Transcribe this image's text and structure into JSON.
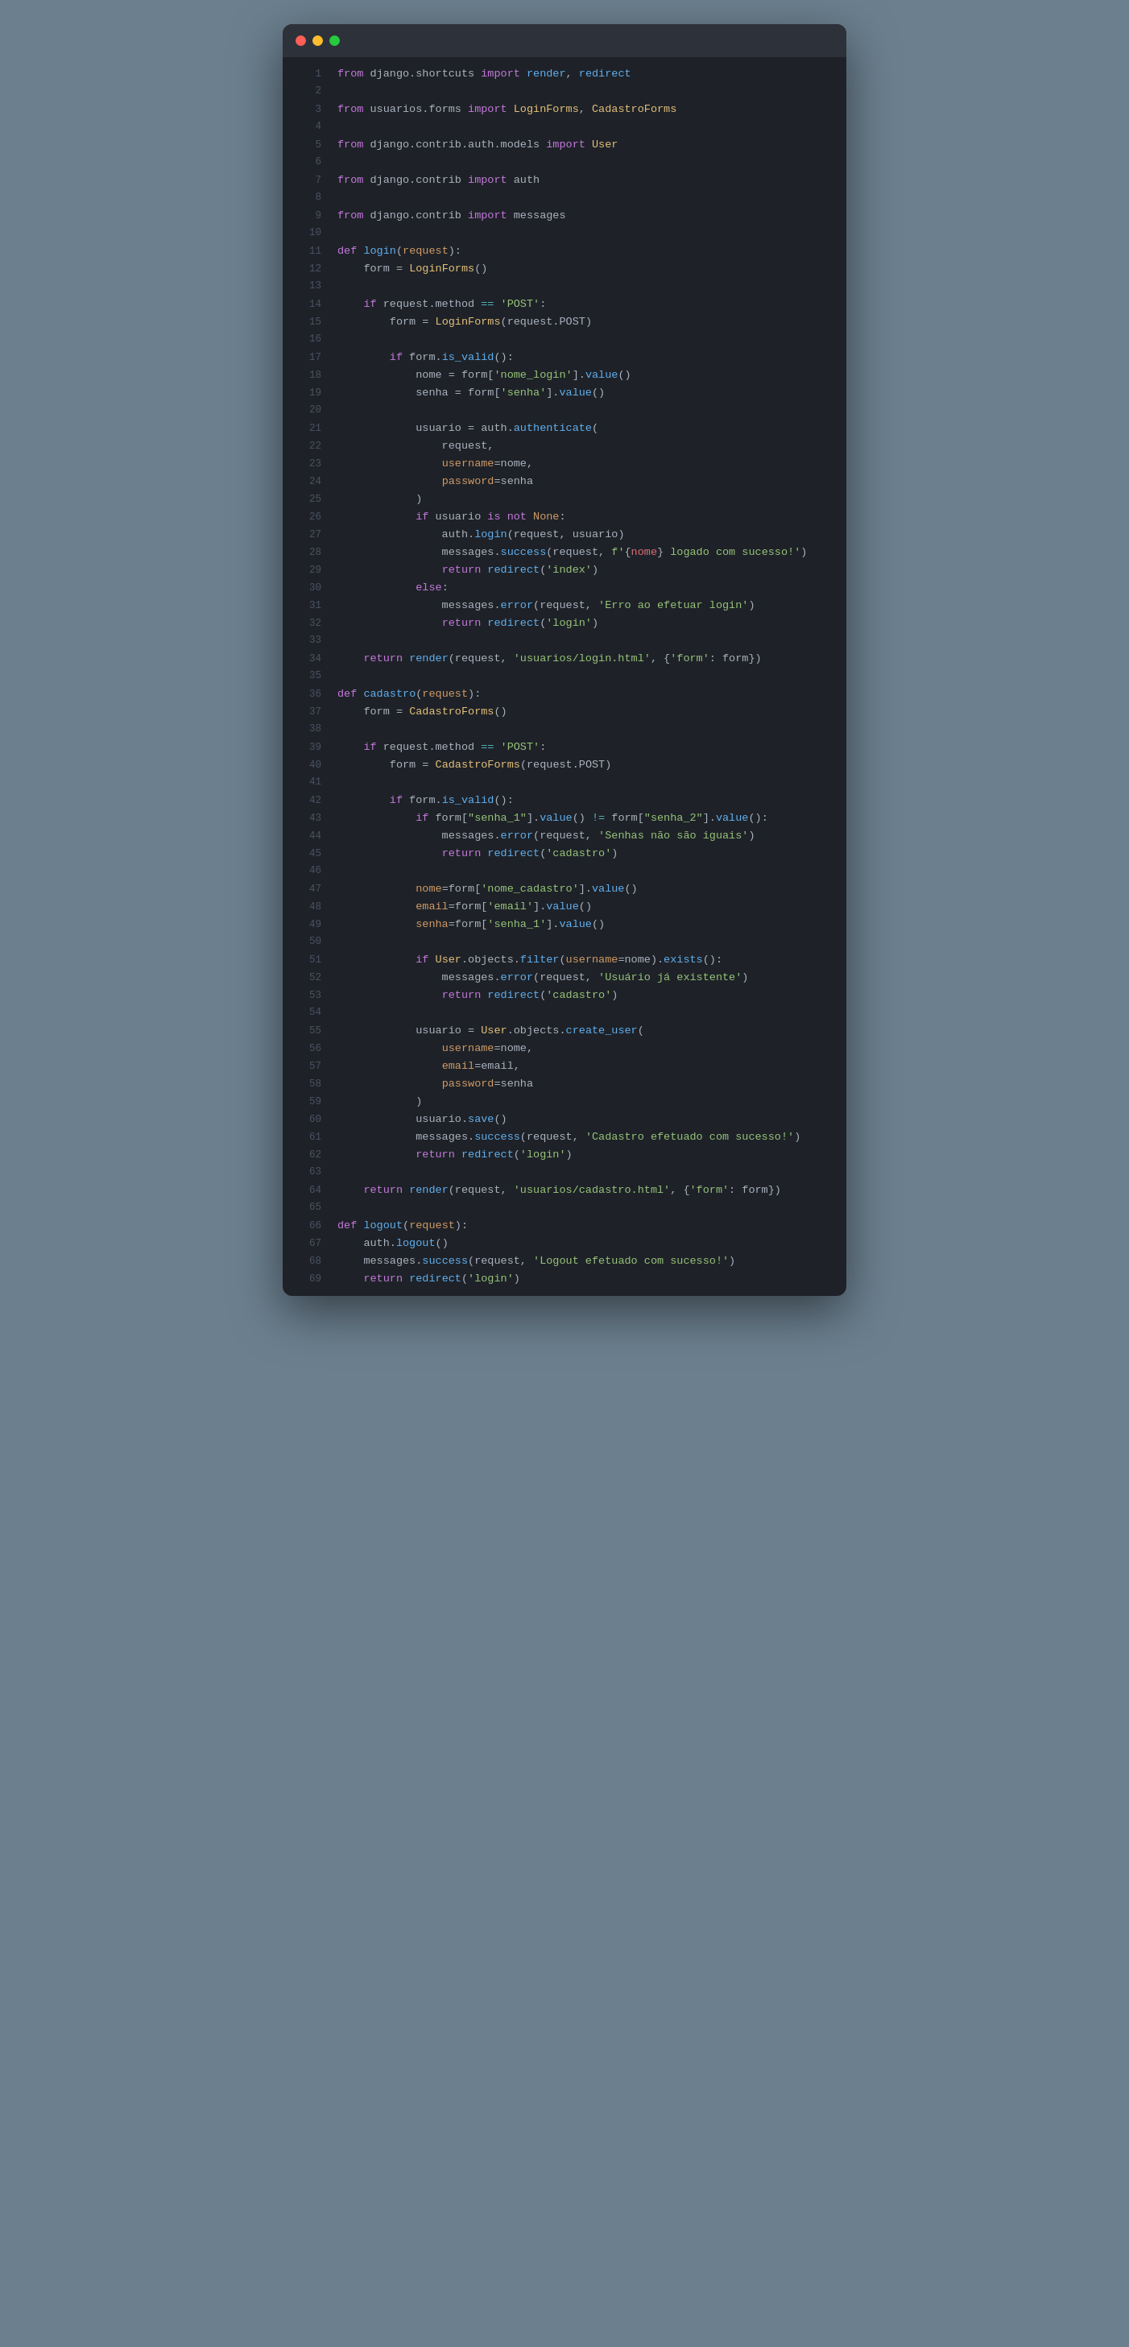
{
  "window": {
    "titlebar": {
      "dot_red": "close",
      "dot_yellow": "minimize",
      "dot_green": "maximize"
    }
  },
  "code": {
    "lines": [
      {
        "n": 1,
        "text": "from django.shortcuts import render, redirect"
      },
      {
        "n": 2,
        "text": ""
      },
      {
        "n": 3,
        "text": "from usuarios.forms import LoginForms, CadastroForms"
      },
      {
        "n": 4,
        "text": ""
      },
      {
        "n": 5,
        "text": "from django.contrib.auth.models import User"
      },
      {
        "n": 6,
        "text": ""
      },
      {
        "n": 7,
        "text": "from django.contrib import auth"
      },
      {
        "n": 8,
        "text": ""
      },
      {
        "n": 9,
        "text": "from django.contrib import messages"
      },
      {
        "n": 10,
        "text": ""
      },
      {
        "n": 11,
        "text": "def login(request):"
      },
      {
        "n": 12,
        "text": "    form = LoginForms()"
      },
      {
        "n": 13,
        "text": ""
      },
      {
        "n": 14,
        "text": "    if request.method == 'POST':"
      },
      {
        "n": 15,
        "text": "        form = LoginForms(request.POST)"
      },
      {
        "n": 16,
        "text": ""
      },
      {
        "n": 17,
        "text": "        if form.is_valid():"
      },
      {
        "n": 18,
        "text": "            nome = form['nome_login'].value()"
      },
      {
        "n": 19,
        "text": "            senha = form['senha'].value()"
      },
      {
        "n": 20,
        "text": ""
      },
      {
        "n": 21,
        "text": "            usuario = auth.authenticate("
      },
      {
        "n": 22,
        "text": "                request,"
      },
      {
        "n": 23,
        "text": "                username=nome,"
      },
      {
        "n": 24,
        "text": "                password=senha"
      },
      {
        "n": 25,
        "text": "            )"
      },
      {
        "n": 26,
        "text": "            if usuario is not None:"
      },
      {
        "n": 27,
        "text": "                auth.login(request, usuario)"
      },
      {
        "n": 28,
        "text": "                messages.success(request, f'{nome} logado com sucesso!')"
      },
      {
        "n": 29,
        "text": "                return redirect('index')"
      },
      {
        "n": 30,
        "text": "            else:"
      },
      {
        "n": 31,
        "text": "                messages.error(request, 'Erro ao efetuar login')"
      },
      {
        "n": 32,
        "text": "                return redirect('login')"
      },
      {
        "n": 33,
        "text": ""
      },
      {
        "n": 34,
        "text": "    return render(request, 'usuarios/login.html', {'form': form})"
      },
      {
        "n": 35,
        "text": ""
      },
      {
        "n": 36,
        "text": "def cadastro(request):"
      },
      {
        "n": 37,
        "text": "    form = CadastroForms()"
      },
      {
        "n": 38,
        "text": ""
      },
      {
        "n": 39,
        "text": "    if request.method == 'POST':"
      },
      {
        "n": 40,
        "text": "        form = CadastroForms(request.POST)"
      },
      {
        "n": 41,
        "text": ""
      },
      {
        "n": 42,
        "text": "        if form.is_valid():"
      },
      {
        "n": 43,
        "text": "            if form[\"senha_1\"].value() != form[\"senha_2\"].value():"
      },
      {
        "n": 44,
        "text": "                messages.error(request, 'Senhas não são iguais')"
      },
      {
        "n": 45,
        "text": "                return redirect('cadastro')"
      },
      {
        "n": 46,
        "text": ""
      },
      {
        "n": 47,
        "text": "            nome=form['nome_cadastro'].value()"
      },
      {
        "n": 48,
        "text": "            email=form['email'].value()"
      },
      {
        "n": 49,
        "text": "            senha=form['senha_1'].value()"
      },
      {
        "n": 50,
        "text": ""
      },
      {
        "n": 51,
        "text": "            if User.objects.filter(username=nome).exists():"
      },
      {
        "n": 52,
        "text": "                messages.error(request, 'Usuário já existente')"
      },
      {
        "n": 53,
        "text": "                return redirect('cadastro')"
      },
      {
        "n": 54,
        "text": ""
      },
      {
        "n": 55,
        "text": "            usuario = User.objects.create_user("
      },
      {
        "n": 56,
        "text": "                username=nome,"
      },
      {
        "n": 57,
        "text": "                email=email,"
      },
      {
        "n": 58,
        "text": "                password=senha"
      },
      {
        "n": 59,
        "text": "            )"
      },
      {
        "n": 60,
        "text": "            usuario.save()"
      },
      {
        "n": 61,
        "text": "            messages.success(request, 'Cadastro efetuado com sucesso!')"
      },
      {
        "n": 62,
        "text": "            return redirect('login')"
      },
      {
        "n": 63,
        "text": ""
      },
      {
        "n": 64,
        "text": "    return render(request, 'usuarios/cadastro.html', {'form': form})"
      },
      {
        "n": 65,
        "text": ""
      },
      {
        "n": 66,
        "text": "def logout(request):"
      },
      {
        "n": 67,
        "text": "    auth.logout()"
      },
      {
        "n": 68,
        "text": "    messages.success(request, 'Logout efetuado com sucesso!')"
      },
      {
        "n": 69,
        "text": "    return redirect('login')"
      }
    ]
  }
}
